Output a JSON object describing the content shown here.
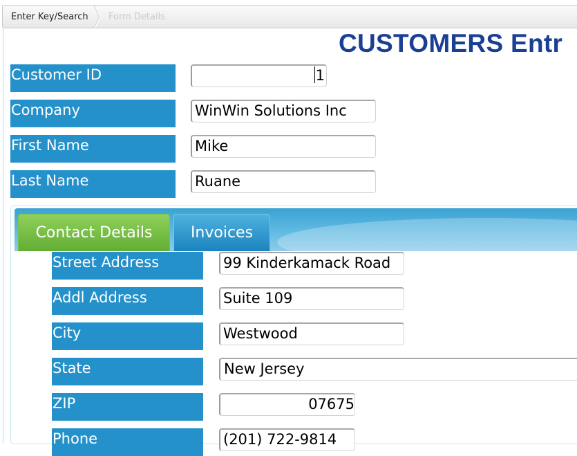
{
  "breadcrumb": {
    "step1": "Enter Key/Search",
    "step2": "Form Details"
  },
  "page": {
    "title": "CUSTOMERS Entr"
  },
  "customer": {
    "id_label": "Customer ID",
    "id_value": "1",
    "company_label": "Company",
    "company_value": "WinWin Solutions Inc",
    "first_label": "First Name",
    "first_value": "Mike",
    "last_label": "Last Name",
    "last_value": "Ruane"
  },
  "tabs": {
    "contact": "Contact Details",
    "invoices": "Invoices"
  },
  "contact": {
    "street_label": "Street Address",
    "street_value": "99 Kinderkamack Road",
    "addl_label": "Addl Address",
    "addl_value": "Suite 109",
    "city_label": "City",
    "city_value": "Westwood",
    "state_label": "State",
    "state_value": "New Jersey",
    "zip_label": "ZIP",
    "zip_value": "07675",
    "phone_label": "Phone",
    "phone_value": "(201) 722-9814"
  },
  "colors": {
    "label_bg": "#2591cb",
    "title": "#1a3f93",
    "tab_active": "#62ae33",
    "tab_inactive": "#1b83bf"
  }
}
